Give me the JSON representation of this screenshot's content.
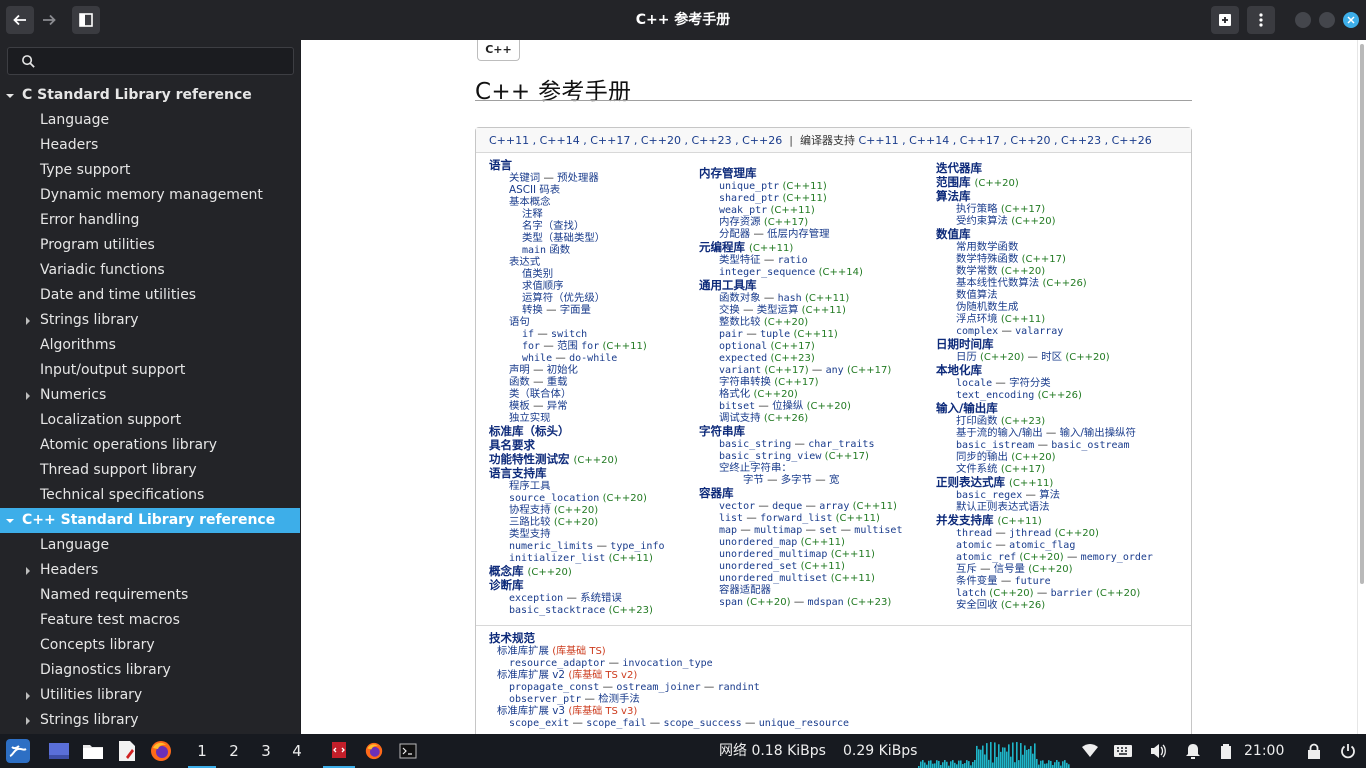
{
  "window": {
    "title": "C++ 参考手册"
  },
  "search": {
    "placeholder": ""
  },
  "sidebar": {
    "sections": [
      {
        "label": "C Standard Library reference",
        "expanded": true,
        "selected": false,
        "items": [
          {
            "label": "Language",
            "expandable": false
          },
          {
            "label": "Headers",
            "expandable": false
          },
          {
            "label": "Type support",
            "expandable": false
          },
          {
            "label": "Dynamic memory management",
            "expandable": false
          },
          {
            "label": "Error handling",
            "expandable": false
          },
          {
            "label": "Program utilities",
            "expandable": false
          },
          {
            "label": "Variadic functions",
            "expandable": false
          },
          {
            "label": "Date and time utilities",
            "expandable": false
          },
          {
            "label": "Strings library",
            "expandable": true
          },
          {
            "label": "Algorithms",
            "expandable": false
          },
          {
            "label": "Input/output support",
            "expandable": false
          },
          {
            "label": "Numerics",
            "expandable": true
          },
          {
            "label": "Localization support",
            "expandable": false
          },
          {
            "label": "Atomic operations library",
            "expandable": false
          },
          {
            "label": "Thread support library",
            "expandable": false
          },
          {
            "label": "Technical specifications",
            "expandable": false
          }
        ]
      },
      {
        "label": "C++ Standard Library reference",
        "expanded": true,
        "selected": true,
        "items": [
          {
            "label": "Language",
            "expandable": false
          },
          {
            "label": "Headers",
            "expandable": true
          },
          {
            "label": "Named requirements",
            "expandable": false
          },
          {
            "label": "Feature test macros",
            "expandable": false
          },
          {
            "label": "Concepts library",
            "expandable": false
          },
          {
            "label": "Diagnostics library",
            "expandable": false
          },
          {
            "label": "Utilities library",
            "expandable": true
          },
          {
            "label": "Strings library",
            "expandable": true
          }
        ]
      }
    ]
  },
  "page": {
    "tab": "C++",
    "title": "C++ 参考手册",
    "versions": [
      "C++11",
      "C++14",
      "C++17",
      "C++20",
      "C++23",
      "C++26"
    ],
    "compiler_label": "编译器支持",
    "compiler_versions": [
      "C++11",
      "C++14",
      "C++17",
      "C++20",
      "C++23",
      "C++26"
    ],
    "columns": [
      [
        {
          "k": "h",
          "t": "语言"
        },
        {
          "k": "i1",
          "t": "关键词 — 预处理器"
        },
        {
          "k": "i1",
          "t": "ASCII 码表"
        },
        {
          "k": "i1",
          "t": "基本概念"
        },
        {
          "k": "i2",
          "t": "注释"
        },
        {
          "k": "i2",
          "t": "名字（查找）"
        },
        {
          "k": "i2",
          "t": "类型（基础类型）"
        },
        {
          "k": "i2",
          "t": "main 函数"
        },
        {
          "k": "i1",
          "t": "表达式"
        },
        {
          "k": "i2",
          "t": "值类别"
        },
        {
          "k": "i2",
          "t": "求值顺序"
        },
        {
          "k": "i2",
          "t": "运算符（优先级）"
        },
        {
          "k": "i2",
          "t": "转换 — 字面量"
        },
        {
          "k": "i1",
          "t": "语句"
        },
        {
          "k": "i2",
          "t": "if — switch"
        },
        {
          "k": "i2",
          "t": "for — 范围 for",
          "v": "(C++11)"
        },
        {
          "k": "i2",
          "t": "while — do-while"
        },
        {
          "k": "i1",
          "t": "声明 — 初始化"
        },
        {
          "k": "i1",
          "t": "函数 — 重载"
        },
        {
          "k": "i1",
          "t": "类（联合体）"
        },
        {
          "k": "i1",
          "t": "模板 — 异常"
        },
        {
          "k": "i1",
          "t": "独立实现"
        },
        {
          "k": "h",
          "t": "标准库（标头）"
        },
        {
          "k": "h",
          "t": "具名要求"
        },
        {
          "k": "h",
          "t": "功能特性测试宏",
          "v": "(C++20)"
        },
        {
          "k": "h",
          "t": "语言支持库"
        },
        {
          "k": "i1",
          "t": "程序工具"
        },
        {
          "k": "i1",
          "t": "source_location",
          "v": "(C++20)"
        },
        {
          "k": "i1",
          "t": "协程支持",
          "v": "(C++20)"
        },
        {
          "k": "i1",
          "t": "三路比较",
          "v": "(C++20)"
        },
        {
          "k": "i1",
          "t": "类型支持"
        },
        {
          "k": "i1",
          "t": "numeric_limits — type_info"
        },
        {
          "k": "i1",
          "t": "initializer_list",
          "v": "(C++11)"
        },
        {
          "k": "h",
          "t": "概念库",
          "v": "(C++20)"
        },
        {
          "k": "h",
          "t": "诊断库"
        },
        {
          "k": "i1",
          "t": "exception — 系统错误"
        },
        {
          "k": "i1",
          "t": "basic_stacktrace",
          "v": "(C++23)"
        }
      ],
      [
        {
          "k": "h",
          "t": "内存管理库"
        },
        {
          "k": "i1",
          "t": "unique_ptr",
          "v": "(C++11)"
        },
        {
          "k": "i1",
          "t": "shared_ptr",
          "v": "(C++11)"
        },
        {
          "k": "i1",
          "t": "weak_ptr",
          "v": "(C++11)"
        },
        {
          "k": "i1",
          "t": "内存资源",
          "v": "(C++17)"
        },
        {
          "k": "i1",
          "t": "分配器 — 低层内存管理"
        },
        {
          "k": "h",
          "t": "元编程库",
          "v": "(C++11)"
        },
        {
          "k": "i1",
          "t": "类型特征 — ratio"
        },
        {
          "k": "i1",
          "t": "integer_sequence",
          "v": "(C++14)"
        },
        {
          "k": "h",
          "t": "通用工具库"
        },
        {
          "k": "i1",
          "t": "函数对象 — hash",
          "v": "(C++11)"
        },
        {
          "k": "i1",
          "t": "交换 — 类型运算",
          "v": "(C++11)"
        },
        {
          "k": "i1",
          "t": "整数比较",
          "v": "(C++20)"
        },
        {
          "k": "i1",
          "t": "pair — tuple",
          "v": "(C++11)"
        },
        {
          "k": "i1",
          "t": "optional",
          "v": "(C++17)"
        },
        {
          "k": "i1",
          "t": "expected",
          "v": "(C++23)"
        },
        {
          "k": "i1",
          "t": "variant (C++17) — any",
          "v": "(C++17)"
        },
        {
          "k": "i1",
          "t": "字符串转换",
          "v": "(C++17)"
        },
        {
          "k": "i1",
          "t": "格式化",
          "v": "(C++20)"
        },
        {
          "k": "i1",
          "t": "bitset — 位操纵",
          "v": "(C++20)"
        },
        {
          "k": "i1",
          "t": "调试支持",
          "v": "(C++26)"
        },
        {
          "k": "h",
          "t": "字符串库"
        },
        {
          "k": "i1",
          "t": "basic_string — char_traits"
        },
        {
          "k": "i1",
          "t": "basic_string_view",
          "v": "(C++17)"
        },
        {
          "k": "i1",
          "t": "空终止字符串："
        },
        {
          "k": "i3",
          "t": "字节 — 多字节 — 宽"
        },
        {
          "k": "h",
          "t": "容器库"
        },
        {
          "k": "i1",
          "t": "vector — deque — array",
          "v": "(C++11)"
        },
        {
          "k": "i1",
          "t": "list — forward_list",
          "v": "(C++11)"
        },
        {
          "k": "i1",
          "t": "map — multimap — set — multiset"
        },
        {
          "k": "i1",
          "t": "unordered_map",
          "v": "(C++11)"
        },
        {
          "k": "i1",
          "t": "unordered_multimap",
          "v": "(C++11)"
        },
        {
          "k": "i1",
          "t": "unordered_set",
          "v": "(C++11)"
        },
        {
          "k": "i1",
          "t": "unordered_multiset",
          "v": "(C++11)"
        },
        {
          "k": "i1",
          "t": "容器适配器"
        },
        {
          "k": "i1",
          "t": "span (C++20) — mdspan",
          "v": "(C++23)"
        }
      ],
      [
        {
          "k": "h",
          "t": "迭代器库"
        },
        {
          "k": "h",
          "t": "范围库",
          "v": "(C++20)"
        },
        {
          "k": "h",
          "t": "算法库"
        },
        {
          "k": "i1",
          "t": "执行策略",
          "v": "(C++17)"
        },
        {
          "k": "i1",
          "t": "受约束算法",
          "v": "(C++20)"
        },
        {
          "k": "h",
          "t": "数值库"
        },
        {
          "k": "i1",
          "t": "常用数学函数"
        },
        {
          "k": "i1",
          "t": "数学特殊函数",
          "v": "(C++17)"
        },
        {
          "k": "i1",
          "t": "数学常数",
          "v": "(C++20)"
        },
        {
          "k": "i1",
          "t": "基本线性代数算法",
          "v": "(C++26)"
        },
        {
          "k": "i1",
          "t": "数值算法"
        },
        {
          "k": "i1",
          "t": "伪随机数生成"
        },
        {
          "k": "i1",
          "t": "浮点环境",
          "v": "(C++11)"
        },
        {
          "k": "i1",
          "t": "complex — valarray"
        },
        {
          "k": "h",
          "t": "日期时间库"
        },
        {
          "k": "i1",
          "t": "日历 (C++20) — 时区",
          "v": "(C++20)"
        },
        {
          "k": "h",
          "t": "本地化库"
        },
        {
          "k": "i1",
          "t": "locale — 字符分类"
        },
        {
          "k": "i1",
          "t": "text_encoding",
          "v": "(C++26)"
        },
        {
          "k": "h",
          "t": "输入/输出库"
        },
        {
          "k": "i1",
          "t": "打印函数",
          "v": "(C++23)"
        },
        {
          "k": "i1",
          "t": "基于流的输入/输出 — 输入/输出操纵符"
        },
        {
          "k": "i1",
          "t": "basic_istream — basic_ostream"
        },
        {
          "k": "i1",
          "t": "同步的输出",
          "v": "(C++20)"
        },
        {
          "k": "i1",
          "t": "文件系统",
          "v": "(C++17)"
        },
        {
          "k": "h",
          "t": "正则表达式库",
          "v": "(C++11)"
        },
        {
          "k": "i1",
          "t": "basic_regex — 算法"
        },
        {
          "k": "i1",
          "t": "默认正则表达式语法"
        },
        {
          "k": "h",
          "t": "并发支持库",
          "v": "(C++11)"
        },
        {
          "k": "i1",
          "t": "thread — jthread",
          "v": "(C++20)"
        },
        {
          "k": "i1",
          "t": "atomic — atomic_flag"
        },
        {
          "k": "i1",
          "t": "atomic_ref (C++20) — memory_order"
        },
        {
          "k": "i1",
          "t": "互斥 — 信号量",
          "v": "(C++20)"
        },
        {
          "k": "i1",
          "t": "条件变量 — future"
        },
        {
          "k": "i1",
          "t": "latch (C++20) — barrier",
          "v": "(C++20)"
        },
        {
          "k": "i1",
          "t": "安全回收",
          "v": "(C++26)"
        }
      ]
    ],
    "tech_specs": [
      {
        "k": "h",
        "t": "技术规范"
      },
      {
        "k": "ts1",
        "t": "标准库扩展",
        "b": "(库基础 TS)"
      },
      {
        "k": "i1",
        "t": "resource_adaptor — invocation_type"
      },
      {
        "k": "ts1",
        "t": "标准库扩展 v2",
        "b": "(库基础 TS v2)"
      },
      {
        "k": "i1",
        "t": "propagate_const — ostream_joiner — randint"
      },
      {
        "k": "i1",
        "t": "observer_ptr — 检测手法"
      },
      {
        "k": "ts1",
        "t": "标准库扩展 v3",
        "b": "(库基础 TS v3)"
      },
      {
        "k": "i1",
        "t": "scope_exit — scope_fail — scope_success — unique_resource"
      }
    ]
  },
  "taskbar": {
    "desktops": [
      "1",
      "2",
      "3",
      "4"
    ],
    "active_desktop": "1",
    "net_label": "网络",
    "download": "0.18 KiBps",
    "upload": "0.29 KiBps",
    "clock": "21:00",
    "colors": {
      "accent": "#3daee9",
      "graph": "#1eb6c9"
    }
  }
}
